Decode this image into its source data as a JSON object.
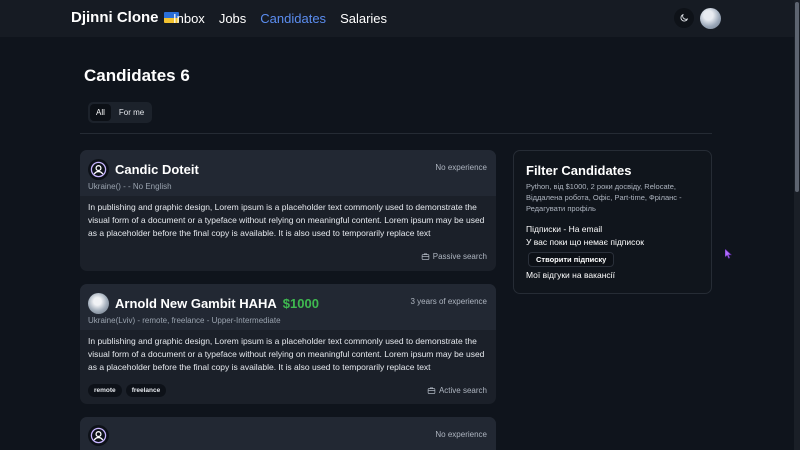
{
  "nav": {
    "brand": "Djinni Clone",
    "links": [
      {
        "label": "Inbox",
        "active": false
      },
      {
        "label": "Jobs",
        "active": false
      },
      {
        "label": "Candidates",
        "active": true
      },
      {
        "label": "Salaries",
        "active": false
      }
    ],
    "theme_icon": "moon-icon",
    "avatar_icon": "user-avatar"
  },
  "page": {
    "title": "Candidates 6",
    "filters": [
      "All",
      "For me"
    ]
  },
  "candidates": [
    {
      "name": "Candic Doteit",
      "salary": "",
      "experience": "No experience",
      "meta": "Ukraine() - - No English",
      "description": "In publishing and graphic design, Lorem ipsum is a placeholder text commonly used to demonstrate the visual form of a document or a typeface without relying on meaningful content. Lorem ipsum may be used as a placeholder before the final copy is available. It is also used to temporarily replace text",
      "tags": [],
      "status": "Passive search"
    },
    {
      "name": "Arnold New Gambit HAHA",
      "salary": "$1000",
      "experience": "3 years of experience",
      "meta": "Ukraine(Lviv) - remote, freelance - Upper-Intermediate",
      "description": "In publishing and graphic design, Lorem ipsum is a placeholder text commonly used to demonstrate the visual form of a document or a typeface without relying on meaningful content. Lorem ipsum may be used as a placeholder before the final copy is available. It is also used to temporarily replace text",
      "tags": [
        "remote",
        "freelance"
      ],
      "status": "Active search"
    },
    {
      "name": "",
      "salary": "",
      "experience": "No experience",
      "meta": "",
      "description": "",
      "tags": [],
      "status": ""
    }
  ],
  "filter_panel": {
    "title": "Filter Candidates",
    "subtitle": "Python, від $1000, 2 роки досвіду, Relocate, Віддалена робота, Офіс, Part-time, Фріланс - Редагувати профіль",
    "subscriptions": "Підписки - На email",
    "no_subscriptions": "У вас поки що немає підписок",
    "create_button": "Створити підписку",
    "my_responses": "Мої відгуки на вакансії"
  },
  "colors": {
    "accent": "#5b8def",
    "salary": "#3fb950",
    "background": "#0f141c",
    "card": "#1b2029"
  }
}
